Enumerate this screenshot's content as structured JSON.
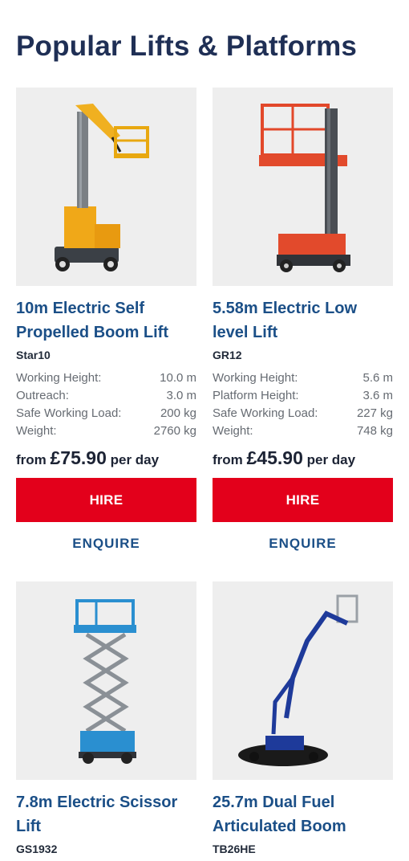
{
  "page": {
    "title": "Popular Lifts & Platforms"
  },
  "products": [
    {
      "title": "10m Electric Self Propelled Boom Lift",
      "model": "Star10",
      "specs": [
        {
          "label": "Working Height:",
          "value": "10.0 m"
        },
        {
          "label": "Outreach:",
          "value": "3.0 m"
        },
        {
          "label": "Safe Working Load:",
          "value": "200 kg"
        },
        {
          "label": "Weight:",
          "value": "2760 kg"
        }
      ],
      "price_prefix": "from",
      "price_amount": "£75.90",
      "price_suffix": "per day",
      "hire_label": "HIRE",
      "enquire_label": "ENQUIRE",
      "image_icon": "boom-lift-image"
    },
    {
      "title": "5.58m Electric Low level Lift",
      "model": "GR12",
      "specs": [
        {
          "label": "Working Height:",
          "value": "5.6 m"
        },
        {
          "label": "Platform Height:",
          "value": "3.6 m"
        },
        {
          "label": "Safe Working Load:",
          "value": "227 kg"
        },
        {
          "label": "Weight:",
          "value": "748 kg"
        }
      ],
      "price_prefix": "from",
      "price_amount": "£45.90",
      "price_suffix": "per day",
      "hire_label": "HIRE",
      "enquire_label": "ENQUIRE",
      "image_icon": "mast-lift-image"
    },
    {
      "title": "7.8m Electric Scissor Lift",
      "model": "GS1932",
      "image_icon": "scissor-lift-image"
    },
    {
      "title": "25.7m Dual Fuel Articulated Boom",
      "model": "TB26HE",
      "image_icon": "articulated-boom-image"
    }
  ],
  "colors": {
    "title": "#1f2f55",
    "link": "#1b4f87",
    "hire_button": "#e3001b",
    "image_bg": "#eeeeee"
  }
}
